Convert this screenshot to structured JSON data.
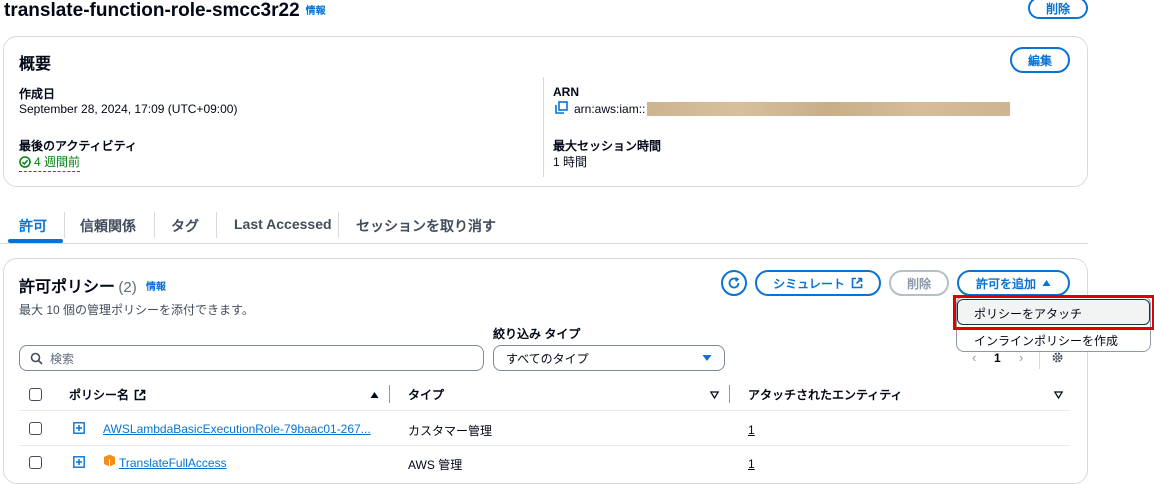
{
  "page": {
    "title": "translate-function-role-smcc3r22",
    "info": "情報",
    "delete_label": "削除"
  },
  "summary": {
    "heading": "概要",
    "edit_label": "編集",
    "created_label": "作成日",
    "created_value": "September 28, 2024, 17:09 (UTC+09:00)",
    "activity_label": "最後のアクティビティ",
    "activity_value": "4 週間前",
    "arn_label": "ARN",
    "arn_prefix": "arn:aws:iam::",
    "session_label": "最大セッション時間",
    "session_value": "1 時間"
  },
  "tabs": [
    {
      "label": "許可",
      "active": true
    },
    {
      "label": "信頼関係"
    },
    {
      "label": "タグ"
    },
    {
      "label": "Last Accessed"
    },
    {
      "label": "セッションを取り消す"
    }
  ],
  "policies": {
    "heading": "許可ポリシー",
    "count": "(2)",
    "info": "情報",
    "description": "最大 10 個の管理ポリシーを添付できます。",
    "simulate_label": "シミュレート",
    "delete_label": "削除",
    "add_label": "許可を追加",
    "filter_type_label": "絞り込み タイプ",
    "search_placeholder": "検索",
    "type_select_value": "すべてのタイプ",
    "page_number": "1",
    "columns": [
      "ポリシー名",
      "タイプ",
      "アタッチされたエンティティ"
    ],
    "rows": [
      {
        "name": "AWSLambdaBasicExecutionRole-79baac01-267...",
        "type": "カスタマー管理",
        "entities": "1",
        "aws_icon": false
      },
      {
        "name": "TranslateFullAccess",
        "type": "AWS 管理",
        "entities": "1",
        "aws_icon": true
      }
    ]
  },
  "add_menu": {
    "items": [
      "ポリシーをアタッチ",
      "インラインポリシーを作成"
    ]
  },
  "colors": {
    "accent": "#0972d3",
    "success": "#037f0c",
    "highlight": "#e00000"
  }
}
